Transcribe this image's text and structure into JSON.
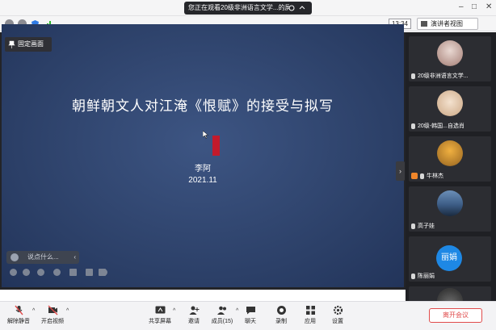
{
  "window": {
    "share_banner": "您正在观看20级非洲语言文学...的屏幕",
    "clock": "13:34",
    "view_button": "演讲者视图"
  },
  "stage": {
    "fixed_button": "固定画面",
    "slide": {
      "title": "朝鲜朝文人对江淹《恨赋》的接受与拟写",
      "author": "李阿",
      "date": "2021.11"
    },
    "chat_placeholder": "说点什么..."
  },
  "gallery": [
    {
      "name": "20级非洲语言文学...",
      "avatar": "photo-portrait",
      "color": "#c9b7b4"
    },
    {
      "name": "20级-韩国...自选肖",
      "avatar": "photo-face",
      "color": "#d7c2ad"
    },
    {
      "name": "牛林杰",
      "avatar": "photo-autumn-tree",
      "color": "#b07a2a"
    },
    {
      "name": "高子娃",
      "avatar": "photo-night-lake",
      "color": "#3d5d86"
    },
    {
      "name": "陈丽娟",
      "avatar": "initials",
      "initials": "丽娟",
      "color": "#1e88e5"
    },
    {
      "name": "",
      "avatar": "photo-plant",
      "color": "#3a3a3a"
    }
  ],
  "bottombar": {
    "unmute": "解除静音",
    "start_video": "开启视频",
    "share_screen": "共享屏幕",
    "invite": "邀请",
    "participants": "成员(15)",
    "chat": "聊天",
    "record": "录制",
    "apps": "应用",
    "settings": "设置",
    "leave": "离开会议"
  },
  "colors": {
    "slide_bg": "#2c4068",
    "tile_bg": "#2c2d32",
    "leave_red": "#e04b4b",
    "seal_red": "#c21a2c"
  }
}
